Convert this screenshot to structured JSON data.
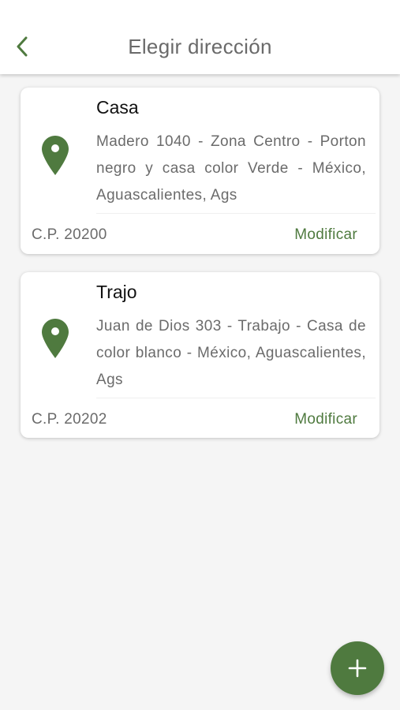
{
  "header": {
    "title": "Elegir dirección",
    "back_icon": "chevron-left-icon"
  },
  "addresses": [
    {
      "name": "Casa",
      "address": "Madero 1040 - Zona Centro - Porton negro y casa color Verde - México, Aguascalientes, Ags",
      "postal_code": "C.P. 20200",
      "action_label": "Modificar",
      "icon": "map-pin-icon"
    },
    {
      "name": "Trajo",
      "address": "Juan de Dios 303 - Trabajo - Casa de color blanco - México, Aguascalientes, Ags",
      "postal_code": "C.P. 20202",
      "action_label": "Modificar",
      "icon": "map-pin-icon"
    }
  ],
  "fab": {
    "icon": "plus-icon"
  },
  "colors": {
    "accent": "#4f7a3f",
    "background": "#f5f5f5",
    "card": "#ffffff",
    "title_text": "#6a6a6a",
    "body_text": "#6b6b6b"
  }
}
